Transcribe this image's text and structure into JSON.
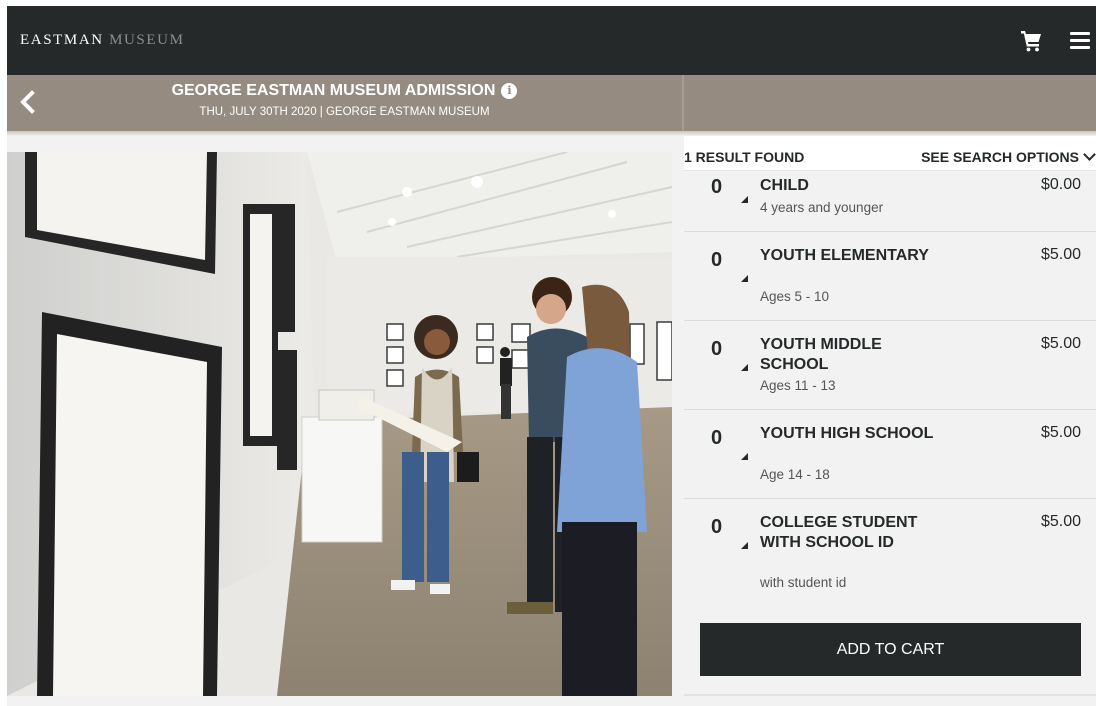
{
  "header": {
    "logo_primary": "EASTMAN",
    "logo_secondary": "MUSEUM",
    "cart_icon": "shopping-cart-icon",
    "menu_icon": "hamburger-menu-icon"
  },
  "event": {
    "title": "GEORGE EASTMAN MUSEUM ADMISSION",
    "subtitle": "THU, JULY 30TH 2020 | GEORGE EASTMAN MUSEUM",
    "back_icon": "chevron-left-icon",
    "info_icon": "info-icon",
    "info_glyph": "i"
  },
  "results": {
    "count_label": "1 RESULT FOUND",
    "search_options_label": "SEE SEARCH OPTIONS"
  },
  "tickets": [
    {
      "qty": "0",
      "name": "CHILD",
      "description": "4 years and younger",
      "price": "$0.00"
    },
    {
      "qty": "0",
      "name": "YOUTH ELEMENTARY",
      "description": "Ages 5 - 10",
      "price": "$5.00"
    },
    {
      "qty": "0",
      "name": "YOUTH MIDDLE SCHOOL",
      "description": "Ages 11 - 13",
      "price": "$5.00"
    },
    {
      "qty": "0",
      "name": "YOUTH HIGH SCHOOL",
      "description": "Age 14 - 18",
      "price": "$5.00"
    },
    {
      "qty": "0",
      "name": "COLLEGE STUDENT WITH SCHOOL ID",
      "description": "with student id",
      "price": "$5.00"
    }
  ],
  "actions": {
    "add_to_cart": "ADD TO CART"
  },
  "colors": {
    "dark": "#25292a",
    "band": "#958b80",
    "panel": "#f2f2f2"
  }
}
